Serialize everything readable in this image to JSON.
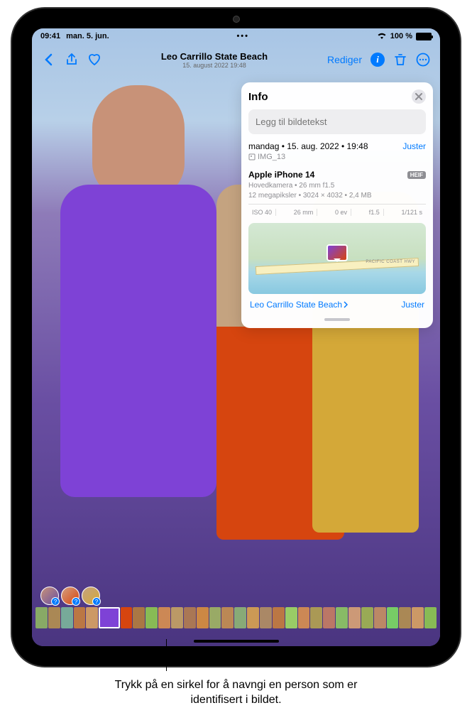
{
  "status": {
    "time": "09:41",
    "date": "man. 5. jun.",
    "battery_text": "100 %"
  },
  "toolbar": {
    "title": "Leo Carrillo State Beach",
    "subtitle": "15. august 2022 19:48",
    "edit_label": "Rediger"
  },
  "info_panel": {
    "title": "Info",
    "caption_placeholder": "Legg til bildetekst",
    "date_line": "mandag • 15. aug. 2022 • 19:48",
    "adjust_label": "Juster",
    "filename": "IMG_13",
    "device_name": "Apple iPhone 14",
    "format_badge": "HEIF",
    "camera_line1": "Hovedkamera • 26 mm f1.5",
    "camera_line2": "12 megapiksler • 3024 × 4032 • 2,4 MB",
    "exif": {
      "iso": "ISO 40",
      "focal": "26 mm",
      "ev": "0 ev",
      "aperture": "f1.5",
      "shutter": "1/121 s"
    },
    "map_road": "PACIFIC COAST HWY",
    "location_name": "Leo Carrillo State Beach",
    "location_adjust": "Juster"
  },
  "callout": {
    "text": "Trykk på en sirkel for å navngi en person som er identifisert i bildet."
  },
  "filmstrip": {
    "colors": [
      "#8a6",
      "#a85",
      "#7a9",
      "#b74",
      "#c96",
      "#7e42d6",
      "#d6450f",
      "#a74",
      "#8b5",
      "#c85",
      "#b96",
      "#a75",
      "#c84",
      "#9a6",
      "#b85",
      "#8a7",
      "#c95",
      "#a86",
      "#b74",
      "#9c6",
      "#c85",
      "#a95",
      "#b76",
      "#8b6",
      "#c97",
      "#9a5",
      "#b86",
      "#7c6",
      "#a85",
      "#c96",
      "#8b5"
    ]
  }
}
